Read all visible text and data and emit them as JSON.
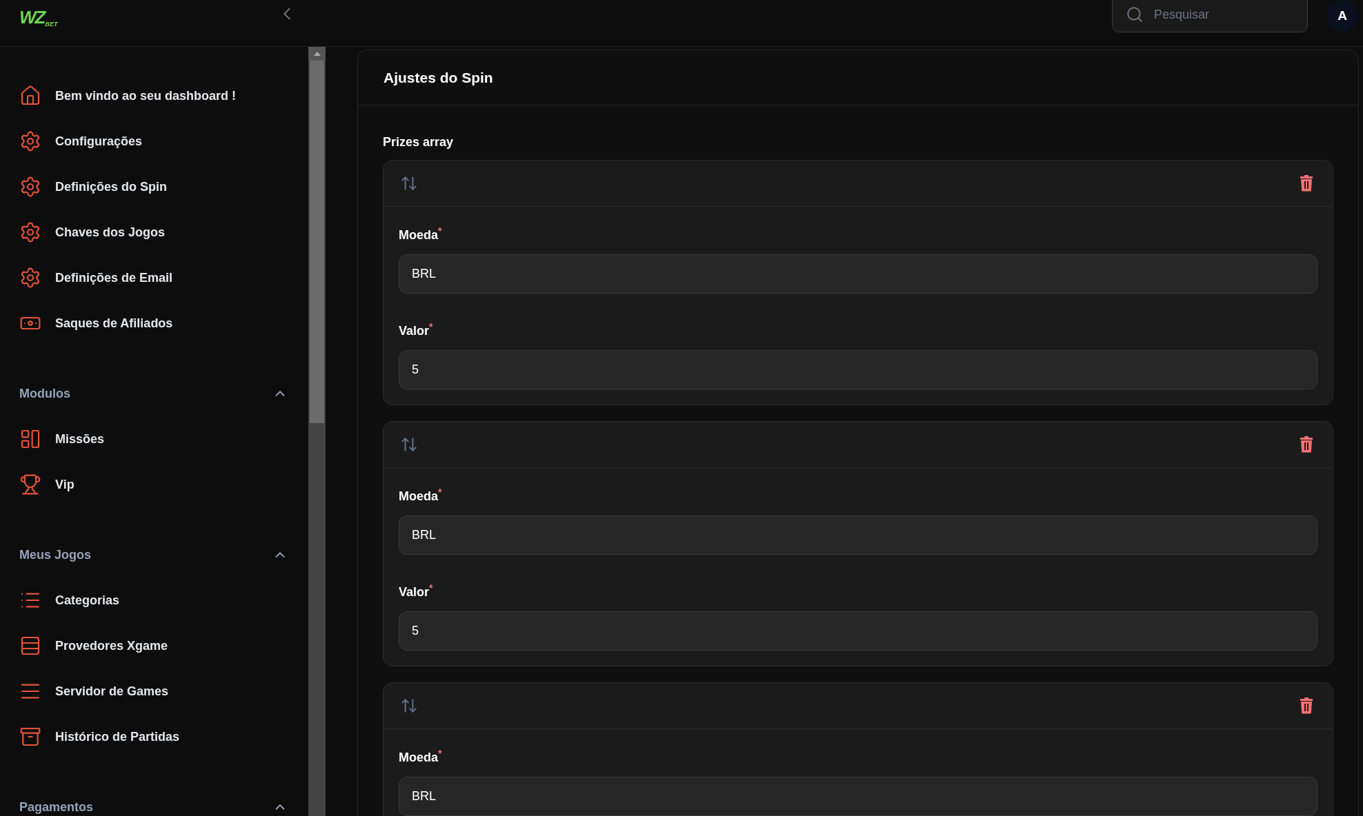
{
  "header": {
    "logo": {
      "mark": "WZ",
      "sub": "BET"
    },
    "search": {
      "placeholder": "Pesquisar"
    },
    "avatar": "A"
  },
  "sidebar": {
    "items": [
      {
        "label": "Bem vindo ao seu dashboard !",
        "kind": "home"
      },
      {
        "label": "Configurações",
        "kind": "gear"
      },
      {
        "label": "Definições do Spin",
        "kind": "gear"
      },
      {
        "label": "Chaves dos Jogos",
        "kind": "gear"
      },
      {
        "label": "Definições de Email",
        "kind": "gear"
      },
      {
        "label": "Saques de Afiliados",
        "kind": "money"
      }
    ],
    "sections": [
      {
        "title": "Modulos",
        "expanded": true,
        "items": [
          {
            "label": "Missões",
            "kind": "panels"
          },
          {
            "label": "Vip",
            "kind": "trophy"
          }
        ]
      },
      {
        "title": "Meus Jogos",
        "expanded": true,
        "items": [
          {
            "label": "Categorias",
            "kind": "list"
          },
          {
            "label": "Provedores Xgame",
            "kind": "stack"
          },
          {
            "label": "Servidor de Games",
            "kind": "lines"
          },
          {
            "label": "Histórico de Partidas",
            "kind": "archive"
          }
        ]
      },
      {
        "title": "Pagamentos",
        "expanded": true
      }
    ]
  },
  "main": {
    "title": "Ajustes do Spin",
    "array_label": "Prizes array",
    "prizes": [
      {
        "fields": [
          {
            "label": "Moeda",
            "required_mark": "*",
            "value": "BRL"
          },
          {
            "label": "Valor",
            "required_mark": "*",
            "value": "5"
          }
        ]
      },
      {
        "fields": [
          {
            "label": "Moeda",
            "required_mark": "*",
            "value": "BRL"
          },
          {
            "label": "Valor",
            "required_mark": "*",
            "value": "5"
          }
        ]
      },
      {
        "fields": [
          {
            "label": "Moeda",
            "required_mark": "*",
            "value": "BRL"
          }
        ]
      }
    ]
  }
}
